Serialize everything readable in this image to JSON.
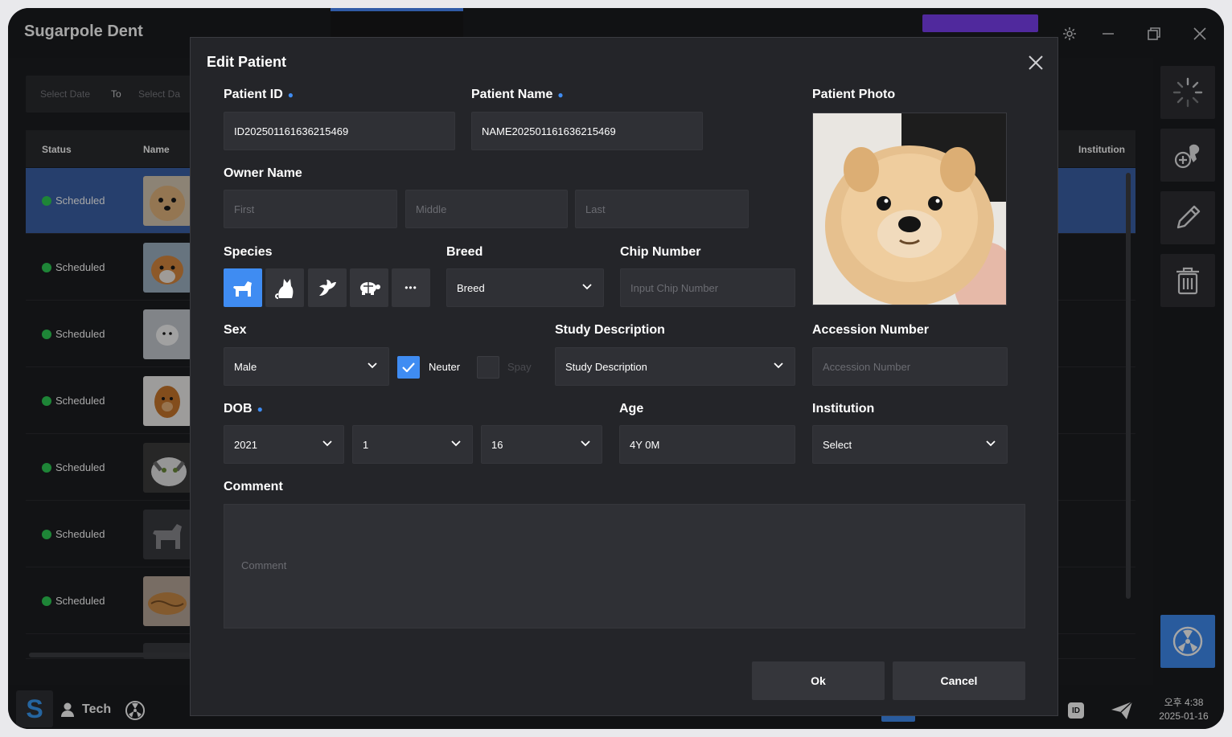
{
  "app": {
    "title": "Sugarpole Dent"
  },
  "filter": {
    "start_placeholder": "Select Date",
    "separator": "To",
    "end_placeholder": "Select Da"
  },
  "table": {
    "headers": {
      "status": "Status",
      "name": "Name",
      "institution": "Institution"
    },
    "rows": [
      {
        "status": "Scheduled",
        "selected": true
      },
      {
        "status": "Scheduled",
        "selected": false
      },
      {
        "status": "Scheduled",
        "selected": false
      },
      {
        "status": "Scheduled",
        "selected": false
      },
      {
        "status": "Scheduled",
        "selected": false
      },
      {
        "status": "Scheduled",
        "selected": false
      },
      {
        "status": "Scheduled",
        "selected": false
      }
    ]
  },
  "modal": {
    "title": "Edit Patient",
    "patient_id": {
      "label": "Patient ID",
      "value": "ID202501161636215469"
    },
    "patient_name": {
      "label": "Patient Name",
      "value": "NAME202501161636215469"
    },
    "patient_photo": {
      "label": "Patient Photo"
    },
    "owner_name": {
      "label": "Owner Name",
      "first_placeholder": "First",
      "middle_placeholder": "Middle",
      "last_placeholder": "Last"
    },
    "species": {
      "label": "Species",
      "options": [
        "dog-icon",
        "cat-icon",
        "bird-icon",
        "turtle-icon",
        "more-icon"
      ],
      "selected": "dog-icon",
      "more_glyph": "•••"
    },
    "breed": {
      "label": "Breed",
      "value": "Breed"
    },
    "chip_number": {
      "label": "Chip Number",
      "placeholder": "Input Chip Number"
    },
    "sex": {
      "label": "Sex",
      "value": "Male",
      "neuter_label": "Neuter",
      "neuter_checked": true,
      "spay_label": "Spay",
      "spay_checked": false
    },
    "study_description": {
      "label": "Study Description",
      "value": "Study Description"
    },
    "accession_number": {
      "label": "Accession Number",
      "placeholder": "Accession Number"
    },
    "dob": {
      "label": "DOB",
      "year": "2021",
      "month": "1",
      "day": "16"
    },
    "age": {
      "label": "Age",
      "value": "4Y 0M"
    },
    "institution": {
      "label": "Institution",
      "value": "Select"
    },
    "comment": {
      "label": "Comment",
      "placeholder": "Comment"
    },
    "ok_label": "Ok",
    "cancel_label": "Cancel"
  },
  "bottombar": {
    "logo": "S",
    "user": "Tech",
    "time": "오후 4:38",
    "date": "2025-01-16",
    "id_badge": "ID"
  },
  "colors": {
    "accent": "#3f8cf2",
    "selected_row": "#3b62a8",
    "status_dot": "#2ecc55",
    "purple": "#7b3ff2",
    "panel": "#242529",
    "field": "#2f3035"
  }
}
